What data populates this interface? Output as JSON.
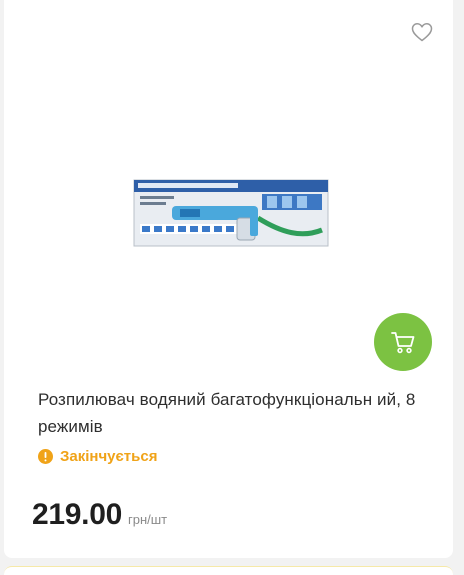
{
  "product": {
    "title": "Розпилювач водяний багатофункціональн ий, 8 режимів",
    "status": "Закінчується",
    "price": "219.00",
    "unit": "грн/шт",
    "image_icon": "product-box-photo",
    "favorite_icon": "heart-icon",
    "cart_icon": "cart-icon",
    "status_icon": "warning-circle-icon"
  },
  "colors": {
    "accent_green": "#7cc242",
    "status_orange": "#f0a318"
  }
}
